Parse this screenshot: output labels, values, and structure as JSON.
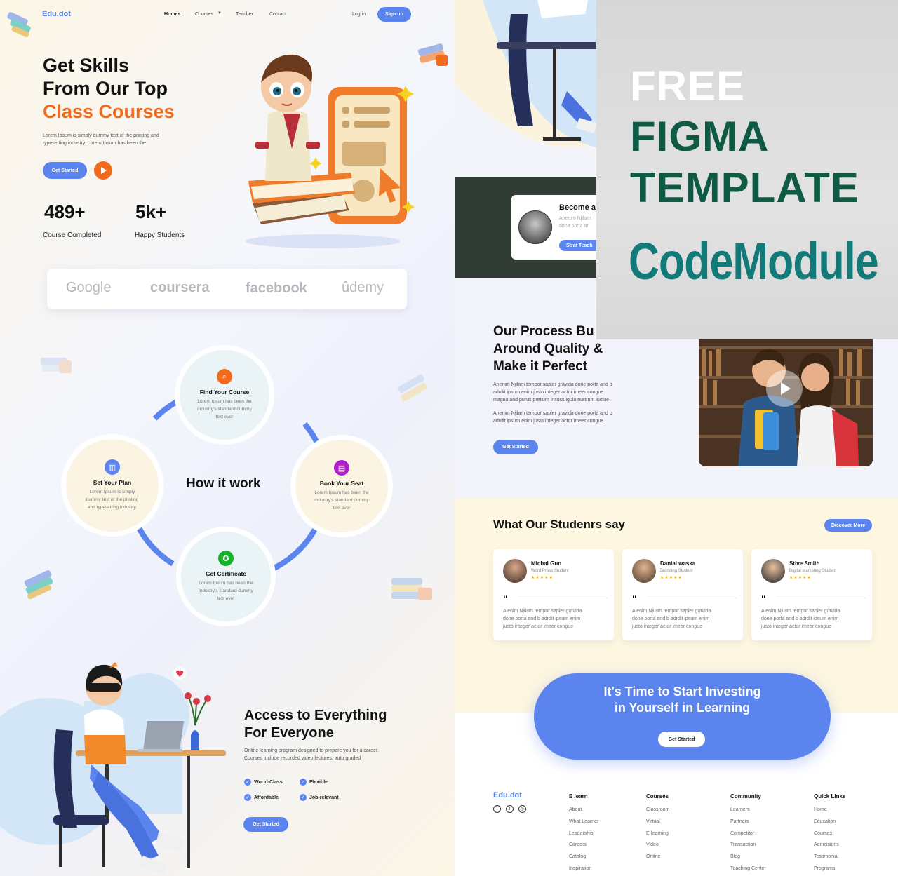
{
  "left": {
    "brand": "Edu.dot",
    "nav": {
      "homes": "Homes",
      "courses": "Courses",
      "teacher": "Teacher",
      "contact": "Contact",
      "login": "Log in",
      "signup": "Sign up"
    },
    "hero": {
      "line1": "Get Skills",
      "line2": "From Our Top",
      "line3": "Class Courses",
      "desc1": "Lorem Ipsum is simply dummy text of the printing and",
      "desc2": "typesetting industry. Lorem Ipsum has been the",
      "cta": "Get Started"
    },
    "stats": [
      {
        "value": "489+",
        "label": "Course Completed"
      },
      {
        "value": "5k+",
        "label": "Happy Students"
      }
    ],
    "partners": [
      "Google",
      "coursera",
      "facebook",
      "ûdemy"
    ],
    "how": {
      "title": "How it work",
      "nodes": [
        {
          "title": "Find Your Course",
          "desc1": "Lorem Ipsum has been the",
          "desc2": "industry's standard dummy",
          "desc3": "text ever"
        },
        {
          "title": "Set Your Plan",
          "desc1": "Lorem Ipsum is simply",
          "desc2": "dummy text of the printing",
          "desc3": "and typesetting industry."
        },
        {
          "title": "Book Your Seat",
          "desc1": "Lorem Ipsum has been the",
          "desc2": "industry's standard dummy",
          "desc3": "text ever"
        },
        {
          "title": "Get Certificate",
          "desc1": "Lorem Ipsum has been the",
          "desc2": "industry's standard dummy",
          "desc3": "text ever"
        }
      ]
    },
    "access": {
      "title1": "Access to Everything",
      "title2": "For Everyone",
      "desc1": "Online learning program designed to prepare you for a  career.",
      "desc2": "Courses include recorded video lectures, auto graded",
      "features": [
        "World-Class",
        "Flexible",
        "Affordable",
        "Job-relevant"
      ],
      "cta": "Get Started"
    }
  },
  "right": {
    "become": {
      "title": "Become a",
      "desc1": "Anenim Njilam",
      "desc2": "done porta ar",
      "cta": "Strat Teach"
    },
    "process": {
      "title1": "Our Process Bu",
      "title2": "Around Quality &",
      "title3": "Make it Perfect",
      "p1a": "Anenim Njilam tempor sapier gravida done porta and b",
      "p1b": "adrdit ipsum enim justo integer actor imeer congue",
      "p1c": "magna and purus pretium insuss igula nurtrum luctue",
      "p2a": "Anenim Njilam tempor sapier gravida done porta and b",
      "p2b": "adrdit ipsum enim justo integer actor imeer congue",
      "cta": "Get Started"
    },
    "testimonials": {
      "title": "What Our Studenrs say",
      "cta": "Discover More",
      "cards": [
        {
          "name": "Michal Gun",
          "role": "Word Press Student",
          "stars": "★★★★★",
          "quote": "“",
          "t1": "A enim Njilam tempor sapier gravida",
          "t2": "done porta and b adrdit ipsum enim",
          "t3": "justo integer actor imeer congue"
        },
        {
          "name": "Danial waska",
          "role": "Branding Student",
          "stars": "★★★★★",
          "quote": "“",
          "t1": "A enim Njilam tempor sapier gravida",
          "t2": "done porta and b adrdit ipsum enim",
          "t3": "justo integer actor imeer congue"
        },
        {
          "name": "Stive Smith",
          "role": "Digital Marketing Student",
          "stars": "★★★★★",
          "quote": "“",
          "t1": "A enim Njilam tempor sapier gravida",
          "t2": "done porta and b adrdit ipsum enim",
          "t3": "justo integer actor imeer congue"
        }
      ]
    },
    "cta_banner": {
      "line1": "It's Time to Start Investing",
      "line2": "in Yourself in Learning",
      "button": "Get Started"
    },
    "footer": {
      "brand": "Edu.dot",
      "cols": [
        {
          "head": "E learn",
          "items": [
            "About",
            "What Learner",
            "Leadership",
            "Careers",
            "Catalog",
            "Inspiration"
          ]
        },
        {
          "head": "Courses",
          "items": [
            "Classroom",
            "Virtual",
            "E-learning",
            "Video",
            "Online"
          ]
        },
        {
          "head": "Community",
          "items": [
            "Learners",
            "Partners",
            "Competitor",
            "Transaction",
            "Blog",
            "Teaching Center"
          ]
        },
        {
          "head": "Quick Links",
          "items": [
            "Home",
            "Education",
            "Courses",
            "Admissions",
            "Testimonial",
            "Programs"
          ]
        }
      ]
    }
  },
  "overlay": {
    "free": "FREE",
    "figma": "FIGMA",
    "template": "TEMPLATE",
    "code": "CodeModule"
  },
  "colors": {
    "primary": "#5b84ee",
    "accent_orange": "#f26a1b",
    "overlay_green": "#0f5a44",
    "overlay_teal": "#127a78"
  }
}
